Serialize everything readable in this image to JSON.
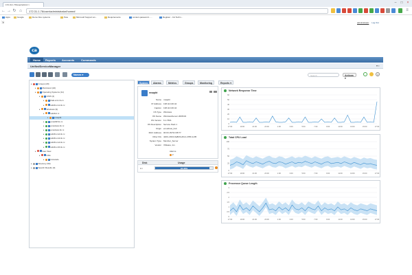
{
  "browser": {
    "tab_title": "172.31.1.76/user/admin/ ×",
    "url": "172.31.1.76/user/administrator/home#",
    "bookmarks": [
      "Apps",
      "Google",
      "Demo Dev systems",
      "Pete",
      "Microsoft Support an...",
      "Requirements",
      "content-password - ...",
      "Register - CA Techn..."
    ]
  },
  "user": {
    "label": "administrator",
    "logout": "Log Out"
  },
  "colors": {
    "menubar": "#3a6ea5",
    "accent": "#3a7dc9",
    "ok": "#3fa34d",
    "chart": "#3a8fd0",
    "band": "#c9e2f5"
  },
  "menu": {
    "items": [
      "Home",
      "Reports",
      "Accounts",
      "Commands"
    ]
  },
  "page": {
    "title": "UnifiedServiceManager"
  },
  "toolbar": {
    "names_label": "Names ▾",
    "search_placeholder": "Search",
    "actions_label": "Actions ▾"
  },
  "tree": [
    {
      "depth": 0,
      "label": "Groups (29)",
      "icon": "red"
    },
    {
      "depth": 1,
      "label": "Monitored (24)",
      "icon": "orange"
    },
    {
      "depth": 1,
      "label": "Operating Systems (11)",
      "icon": "orange"
    },
    {
      "depth": 2,
      "label": "UNIX (2)",
      "icon": "orange"
    },
    {
      "depth": 3,
      "label": "lhall-vm1.ifo.rx",
      "icon": "orange"
    },
    {
      "depth": 3,
      "label": "w2k8-vm1.ifo.rx",
      "icon": "orange"
    },
    {
      "depth": 2,
      "label": "Windows (9)",
      "icon": "orange"
    },
    {
      "depth": 3,
      "label": "w2k8-tl.rx",
      "icon": "orange"
    },
    {
      "depth": 4,
      "label": "msapbt",
      "icon": "orange",
      "selected": true
    },
    {
      "depth": 3,
      "label": "enw2k8.ifo.rx",
      "icon": "green"
    },
    {
      "depth": 3,
      "label": "enwdows.ifo.rx",
      "icon": "green"
    },
    {
      "depth": 3,
      "label": "enwdows.ifo.rx",
      "icon": "green"
    },
    {
      "depth": 3,
      "label": "w2k8-vm2.ifo.rx",
      "icon": "green"
    },
    {
      "depth": 3,
      "label": "w2k8-vm3.ifo.rx",
      "icon": "green"
    },
    {
      "depth": 3,
      "label": "w2k8-vm4.ifo.rx",
      "icon": "green"
    },
    {
      "depth": 3,
      "label": "w2k8-vm5.ifo.rx",
      "icon": "green"
    },
    {
      "depth": 1,
      "label": "Geo View",
      "icon": "red"
    },
    {
      "depth": 2,
      "label": "USA",
      "icon": "red"
    },
    {
      "depth": 3,
      "label": "Colorado",
      "icon": "orange"
    },
    {
      "depth": 0,
      "label": "Directory (50)",
      "icon": "gray"
    },
    {
      "depth": 0,
      "label": "Search Results (0)",
      "icon": "gray"
    }
  ],
  "detail_tabs": [
    "System",
    "Alarms",
    "Metrics",
    "Groups",
    "Monitoring",
    "Reports ▾"
  ],
  "device": {
    "name": "msapbt",
    "fields": [
      {
        "label": "Name",
        "value": "msapbt"
      },
      {
        "label": "IP Address",
        "value": "138.42.136.44"
      },
      {
        "label": "Caption",
        "value": "138.42.136.44"
      },
      {
        "label": "OS Type",
        "value": "Windows"
      },
      {
        "label": "OS Name",
        "value": "WindowsServer 2008 R2"
      },
      {
        "label": "OS Version",
        "value": "6.1.7601"
      },
      {
        "label": "OS Description",
        "value": "Service Pack 1"
      },
      {
        "label": "Origin",
        "value": "envuthost_hub"
      },
      {
        "label": "MAC Address",
        "value": "00:0C:29:5C:D8:77"
      },
      {
        "label": "Other IDs",
        "value": "420C-29C0-6a8bf4-d6c1-4780-1c05"
      },
      {
        "label": "System Type",
        "value": "Member_Server"
      },
      {
        "label": "Vendor",
        "value": "VMware, Inc."
      }
    ],
    "alarms_label": "Alarms",
    "alarms_count": "2"
  },
  "disk": {
    "col_disk": "Disk",
    "col_usage": "Usage",
    "row_disk": "C:\\",
    "row_usage": "94.30%",
    "usage_fraction": 0.943
  },
  "charts": [
    {
      "title": "Network Response Time",
      "yticks": [
        "60",
        "50",
        "40",
        "30",
        "20",
        "10",
        "0"
      ]
    },
    {
      "title": "Total CPU Load",
      "yticks": [
        "100",
        "75",
        "50",
        "25",
        "0"
      ]
    },
    {
      "title": "Processor Queue Length",
      "yticks": [
        "3",
        "2.5",
        "2",
        "1.5",
        "1",
        "0.5",
        "0"
      ]
    }
  ],
  "chart_data": [
    {
      "type": "line",
      "title": "Network Response Time",
      "ylim": [
        0,
        60
      ],
      "x": [
        "17:00",
        "19:00",
        "21:00",
        "23:00",
        "1:00",
        "3:00",
        "5:00",
        "7:00",
        "9:00",
        "11:00",
        "13:00",
        "15:00",
        "17:00"
      ],
      "series": [
        {
          "values": [
            3,
            4,
            3,
            14,
            3,
            3,
            4,
            3,
            12,
            3,
            3,
            4,
            3,
            16,
            4,
            3,
            3,
            4,
            12,
            3,
            3,
            4,
            3,
            14,
            3,
            3,
            4,
            3,
            10,
            3,
            4,
            3,
            12,
            3,
            3,
            4,
            18,
            3,
            3,
            4,
            3,
            14,
            3,
            4,
            3,
            46
          ]
        }
      ]
    },
    {
      "type": "area",
      "title": "Total CPU Load",
      "ylim": [
        0,
        100
      ],
      "x": [
        "17:00",
        "19:00",
        "21:00",
        "23:00",
        "1:00",
        "3:00",
        "5:00",
        "7:00",
        "9:00",
        "11:00",
        "13:00",
        "15:00",
        "17:00"
      ],
      "series": [
        {
          "values": [
            18,
            22,
            30,
            26,
            20,
            34,
            28,
            24,
            30,
            26,
            22,
            28,
            32,
            26,
            24,
            30,
            28,
            22,
            26,
            30,
            24,
            28,
            26,
            32,
            28,
            24,
            30,
            26,
            22,
            28,
            30,
            24,
            26,
            28,
            24,
            30,
            26,
            22,
            28,
            24,
            20,
            26,
            22,
            24,
            20,
            18
          ]
        }
      ]
    },
    {
      "type": "area",
      "title": "Processor Queue Length",
      "ylim": [
        0,
        3
      ],
      "x": [
        "17:00",
        "19:00",
        "21:00",
        "23:00",
        "1:00",
        "3:00",
        "5:00",
        "7:00",
        "9:00",
        "11:00",
        "13:00",
        "15:00",
        "17:00"
      ],
      "series": [
        {
          "values": [
            0.6,
            0.9,
            0.5,
            1.2,
            0.7,
            0.9,
            0.6,
            1.1,
            0.8,
            0.5,
            0.9,
            1.4,
            0.7,
            0.8,
            0.6,
            1.0,
            0.7,
            0.9,
            0.6,
            1.2,
            0.8,
            0.7,
            0.9,
            0.6,
            1.0,
            0.8,
            0.7,
            1.1,
            0.6,
            0.9,
            0.7,
            0.8,
            0.6,
            1.0,
            0.7,
            0.8,
            0.6,
            0.9,
            0.7,
            0.6,
            0.8,
            0.7,
            0.6,
            0.8,
            0.7,
            0.6
          ]
        }
      ]
    }
  ]
}
